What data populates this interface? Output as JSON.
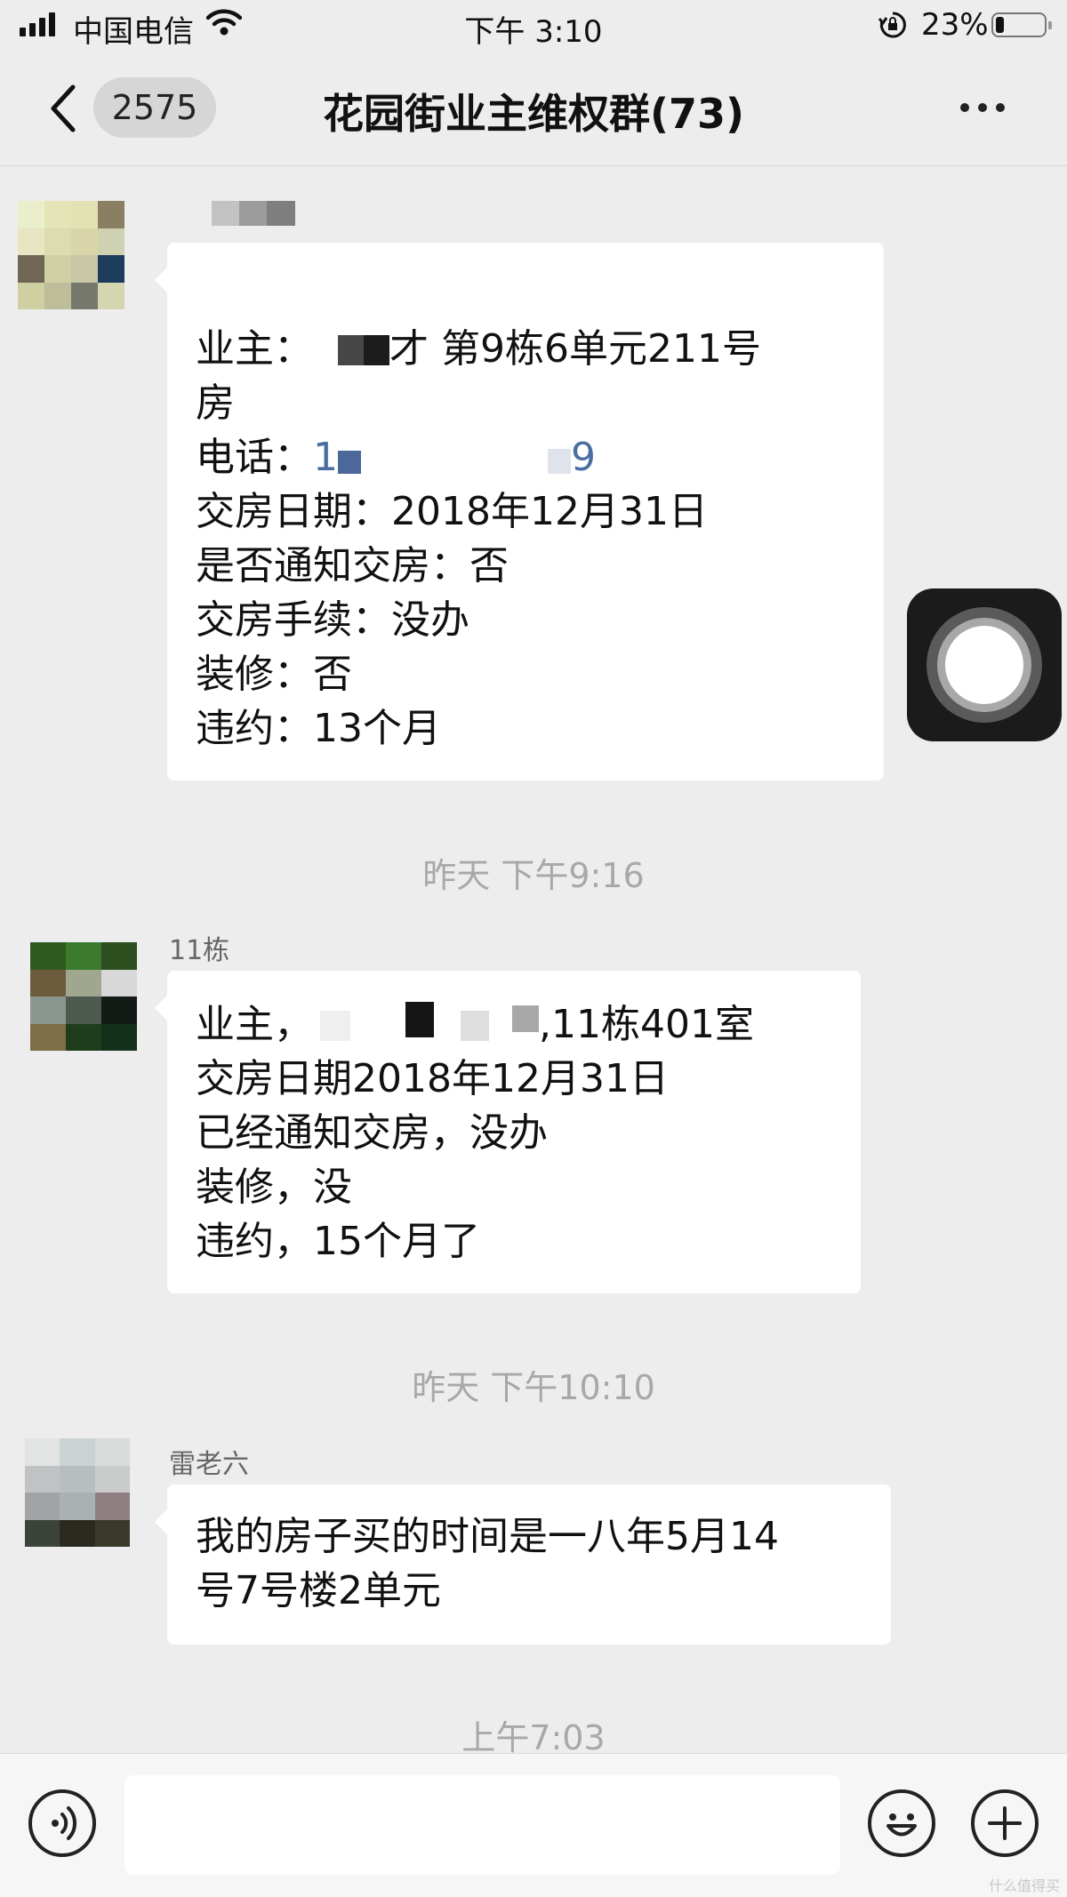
{
  "status_bar": {
    "carrier": "中国电信",
    "time": "下午 3:10",
    "battery": "23%"
  },
  "nav": {
    "unread_count": "2575",
    "title": "花园街业主维权群(73)"
  },
  "messages": [
    {
      "sender": "",
      "lines": {
        "l1_a": "业主：",
        "l1_b": "才 第9栋6单元211号",
        "l2": "房",
        "l3_label": "电话：",
        "l3_a": "1",
        "l3_b": "9",
        "l4": "交房日期：2018年12月31日",
        "l5": "是否通知交房：否",
        "l6": "交房手续：没办",
        "l7": "装修：否",
        "l8": "违约：13个月"
      }
    },
    {
      "time": "昨天 下午9:16",
      "sender": "11栋",
      "lines": {
        "l1_a": "业主，",
        "l1_b": ",11栋401室",
        "l2": "交房日期2018年12月31日",
        "l3": "已经通知交房，没办",
        "l4": "装修，没",
        "l5": "违约，15个月了"
      }
    },
    {
      "time": "昨天 下午10:10",
      "sender": "雷老六",
      "lines": {
        "l1": "我的房子买的时间是一八年5月14",
        "l2": "号7号楼2单元"
      }
    }
  ],
  "last_time": "上午7:03",
  "watermark": "什么值得买",
  "icons": {
    "back": "chevron-left-icon",
    "more": "more-dots-icon",
    "voice": "voice-icon",
    "emoji": "emoji-icon",
    "add": "plus-icon",
    "assistive": "assistive-touch-icon"
  }
}
